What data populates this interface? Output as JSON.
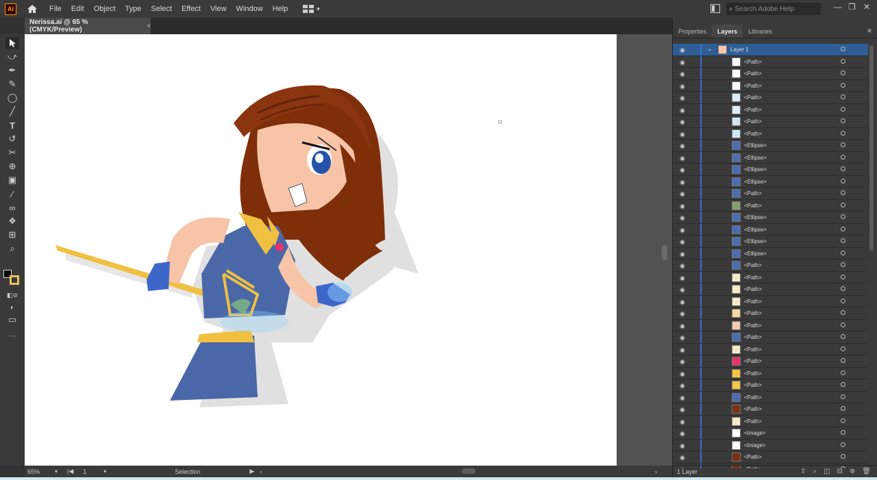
{
  "app": {
    "logo": "Ai"
  },
  "menu": [
    "File",
    "Edit",
    "Object",
    "Type",
    "Select",
    "Effect",
    "View",
    "Window",
    "Help"
  ],
  "search": {
    "placeholder": "Search Adobe Help"
  },
  "document_tab": {
    "title": "Nerissa.ai @ 65 % (CMYK/Preview)",
    "close": "×"
  },
  "panel": {
    "tabs": [
      "Properties",
      "Layers",
      "Libraries"
    ],
    "active_tab": "Layers"
  },
  "layers": {
    "layer_name": "Layer 1",
    "items": [
      "<Path>",
      "<Path>",
      "<Path>",
      "<Path>",
      "<Path>",
      "<Path>",
      "<Path>",
      "<Ellipse>",
      "<Ellipse>",
      "<Ellipse>",
      "<Ellipse>",
      "<Path>",
      "<Path>",
      "<Ellipse>",
      "<Ellipse>",
      "<Ellipse>",
      "<Ellipse>",
      "<Path>",
      "<Path>",
      "<Path>",
      "<Path>",
      "<Path>",
      "<Path>",
      "<Path>",
      "<Path>",
      "<Path>",
      "<Path>",
      "<Path>",
      "<Path>",
      "<Path>",
      "<Path>",
      "<Image>",
      "<Image>",
      "<Path>",
      "<Path>"
    ],
    "thumb_colors": [
      "#ffffff",
      "#ffffff",
      "#ffffff",
      "#d9ecf7",
      "#d9ecf7",
      "#cfe6f5",
      "#cfe6f5",
      "#4a6cb0",
      "#4a6cb0",
      "#4a6cb0",
      "#4a6cb0",
      "#4a6cb0",
      "#8a9a70",
      "#4a6cb0",
      "#4a6cb0",
      "#4a6cb0",
      "#4a6cb0",
      "#4a6cb0",
      "#f5e9c8",
      "#f5e9c8",
      "#f5e9c8",
      "#f5d9a0",
      "#f6c9b0",
      "#4a6cb0",
      "#f5e9c8",
      "#e8336b",
      "#f5c542",
      "#f5c542",
      "#4a6cb0",
      "#7a3010",
      "#f5e9c8",
      "#ffffff",
      "#ffffff",
      "#7a3010",
      "#7a3010"
    ],
    "footer": "1 Layer"
  },
  "status": {
    "zoom": "65%",
    "artboard": "1",
    "tool": "Selection"
  },
  "colors": {
    "accent": "#2e5e95",
    "hair": "#7f2e0a",
    "skin": "#f7c4a8",
    "dress": "#4a68a8",
    "gold": "#f0c040"
  },
  "icons": [
    "home-icon",
    "selection-tool-icon",
    "direct-selection-icon",
    "pen-tool-icon",
    "curvature-tool-icon",
    "ellipse-tool-icon",
    "paintbrush-icon",
    "type-tool-icon",
    "rotate-icon",
    "scissors-icon",
    "shape-builder-icon",
    "gradient-icon",
    "eyedropper-icon",
    "blend-icon",
    "symbol-sprayer-icon",
    "artboard-tool-icon",
    "zoom-tool-icon"
  ]
}
